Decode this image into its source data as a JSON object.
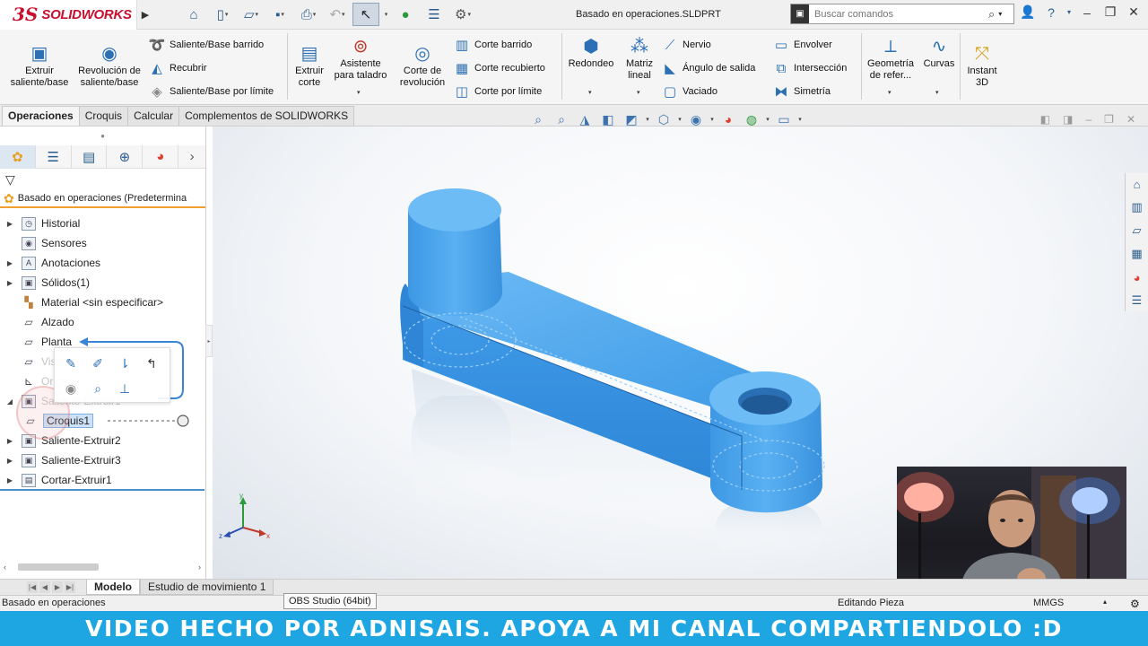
{
  "app": {
    "brand_prefix": "3S",
    "brand_name": "SOLIDWORKS",
    "document_title": "Basado en operaciones.SLDPRT",
    "search_placeholder": "Buscar comandos"
  },
  "ribbon": {
    "extruir_saliente": "Extruir saliente/base",
    "revolucion_saliente": "Revolución de saliente/base",
    "saliente_barrido": "Saliente/Base barrido",
    "recubrir": "Recubrir",
    "saliente_limite": "Saliente/Base por límite",
    "extruir_corte": "Extruir corte",
    "asistente_taladro": "Asistente para taladro",
    "corte_revolucion": "Corte de revolución",
    "corte_barrido": "Corte barrido",
    "corte_recubierto": "Corte recubierto",
    "corte_limite": "Corte por límite",
    "redondeo": "Redondeo",
    "matriz_lineal": "Matriz lineal",
    "nervio": "Nervio",
    "angulo_salida": "Ángulo de salida",
    "vaciado": "Vaciado",
    "envolver": "Envolver",
    "interseccion": "Intersección",
    "simetria": "Simetría",
    "geometria_ref": "Geometría de refer...",
    "curvas": "Curvas",
    "instant3d": "Instant 3D"
  },
  "command_tabs": [
    "Operaciones",
    "Croquis",
    "Calcular",
    "Complementos de SOLIDWORKS"
  ],
  "feature_tree": {
    "root": "Basado en operaciones  (Predetermina",
    "items": [
      {
        "label": "Historial"
      },
      {
        "label": "Sensores"
      },
      {
        "label": "Anotaciones"
      },
      {
        "label": "Sólidos(1)"
      },
      {
        "label": "Material <sin especificar>"
      },
      {
        "label": "Alzado"
      },
      {
        "label": "Planta"
      },
      {
        "label": "Vista lateral"
      },
      {
        "label": "Origen"
      },
      {
        "label": "Saliente-Extruir1"
      },
      {
        "label": "Croquis1"
      },
      {
        "label": "Saliente-Extruir2"
      },
      {
        "label": "Saliente-Extruir3"
      },
      {
        "label": "Cortar-Extruir1"
      }
    ]
  },
  "bottom_tabs": [
    "Modelo",
    "Estudio de movimiento 1"
  ],
  "status": {
    "left": "Basado en operaciones",
    "tooltip": "OBS Studio (64bit)",
    "mode": "Editando Pieza",
    "units": "MMGS"
  },
  "caption": "VIDEO HECHO POR ADNISAIS. APOYA A MI CANAL COMPARTIENDOLO :D",
  "colors": {
    "part": "#4da9f0",
    "caption_bg": "#1ea6e2",
    "brand": "#c8102e"
  }
}
